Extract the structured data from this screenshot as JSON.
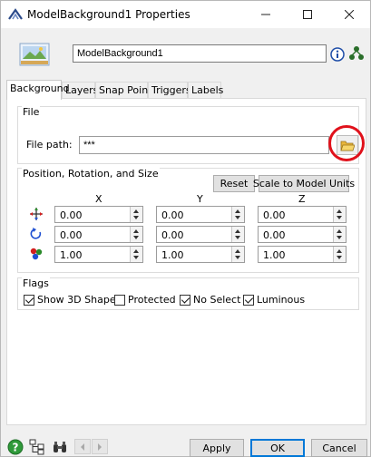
{
  "window": {
    "title": "ModelBackground1 Properties",
    "icons": {
      "app": "flexsim-app-icon",
      "minimize": "minimize-icon",
      "maximize": "maximize-icon",
      "close": "close-icon"
    }
  },
  "header": {
    "object_name": "ModelBackground1",
    "object_icon": "model-background-image-icon",
    "info_icon": "info-icon",
    "tree_icon": "tree-view-icon"
  },
  "tabs": [
    {
      "label": "Background",
      "active": true
    },
    {
      "label": "Layers",
      "active": false
    },
    {
      "label": "Snap Points",
      "active": false
    },
    {
      "label": "Triggers",
      "active": false
    },
    {
      "label": "Labels",
      "active": false
    }
  ],
  "file_group": {
    "title": "File",
    "path_label": "File path:",
    "path_value": "***",
    "browse_icon": "folder-open-icon",
    "highlight_color": "#e0111b"
  },
  "transform_group": {
    "title": "Position, Rotation, and Size",
    "reset_label": "Reset",
    "scale_label": "Scale to Model Units",
    "axes": [
      "X",
      "Y",
      "Z"
    ],
    "rows": [
      {
        "name": "position",
        "icon": "move-arrows-icon",
        "values": [
          "0.00",
          "0.00",
          "0.00"
        ]
      },
      {
        "name": "rotation",
        "icon": "rotate-icon",
        "values": [
          "0.00",
          "0.00",
          "0.00"
        ]
      },
      {
        "name": "size",
        "icon": "scale-icon",
        "values": [
          "1.00",
          "1.00",
          "1.00"
        ]
      }
    ]
  },
  "flags_group": {
    "title": "Flags",
    "flags": [
      {
        "label": "Show 3D Shape",
        "checked": true
      },
      {
        "label": "Protected",
        "checked": false
      },
      {
        "label": "No Select",
        "checked": true
      },
      {
        "label": "Luminous",
        "checked": true
      }
    ]
  },
  "footer": {
    "help_icon": "help-icon",
    "tree_icon": "object-tree-icon",
    "find_icon": "binoculars-icon",
    "prev_icon": "arrow-left-icon",
    "next_icon": "arrow-right-icon",
    "apply_label": "Apply",
    "ok_label": "OK",
    "cancel_label": "Cancel"
  }
}
